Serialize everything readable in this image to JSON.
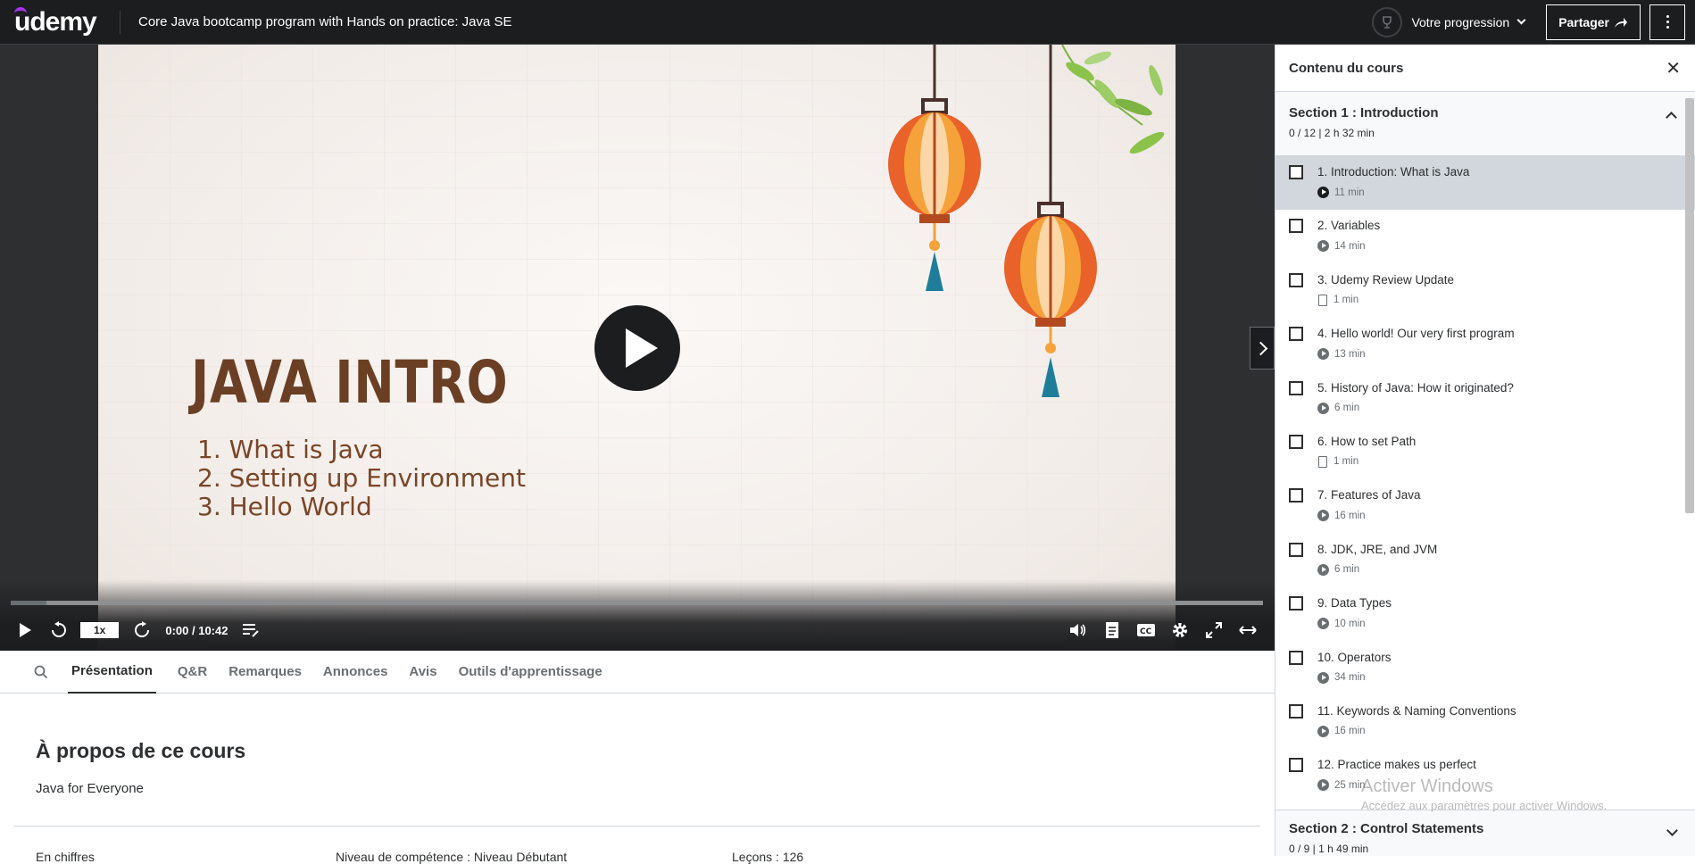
{
  "header": {
    "logo": "udemy",
    "course_title": "Core Java bootcamp program with Hands on practice: Java SE",
    "progress_label": "Votre progression",
    "share_label": "Partager"
  },
  "video": {
    "slide_title": "JAVA INTRO",
    "slide_items": [
      "1. What is Java",
      "2. Setting up Environment",
      "3. Hello World"
    ],
    "speed": "1x",
    "time": "0:00 / 10:42",
    "progress_fraction": 0
  },
  "tabs": [
    "Présentation",
    "Q&R",
    "Remarques",
    "Annonces",
    "Avis",
    "Outils d'apprentissage"
  ],
  "about": {
    "title": "À propos de ce cours",
    "subtitle": "Java for Everyone",
    "cut_row": [
      "En chiffres",
      "Niveau de compétence : Niveau Débutant",
      "Leçons : 126"
    ]
  },
  "sidebar": {
    "title": "Contenu du cours",
    "section1": {
      "title": "Section 1 : Introduction",
      "meta": "0 / 12 | 2 h 32 min"
    },
    "lessons": [
      {
        "title": "1. Introduction: What is Java",
        "duration": "11 min",
        "type": "video"
      },
      {
        "title": "2. Variables",
        "duration": "14 min",
        "type": "video"
      },
      {
        "title": "3. Udemy Review Update",
        "duration": "1 min",
        "type": "doc"
      },
      {
        "title": "4. Hello world! Our very first program",
        "duration": "13 min",
        "type": "video"
      },
      {
        "title": "5. History of Java: How it originated?",
        "duration": "6 min",
        "type": "video"
      },
      {
        "title": "6. How to set Path",
        "duration": "1 min",
        "type": "doc"
      },
      {
        "title": "7. Features of Java",
        "duration": "16 min",
        "type": "video"
      },
      {
        "title": "8. JDK, JRE, and JVM",
        "duration": "6 min",
        "type": "video"
      },
      {
        "title": "9. Data Types",
        "duration": "10 min",
        "type": "video"
      },
      {
        "title": "10. Operators",
        "duration": "34 min",
        "type": "video"
      },
      {
        "title": "11. Keywords & Naming Conventions",
        "duration": "16 min",
        "type": "video"
      },
      {
        "title": "12. Practice makes us perfect",
        "duration": "25 min",
        "type": "video"
      }
    ],
    "section2": {
      "title": "Section 2 : Control Statements",
      "meta": "0 / 9 | 1 h 49 min"
    }
  },
  "watermark": {
    "line1": "Activer Windows",
    "line2": "Accédez aux paramètres pour activer Windows."
  }
}
